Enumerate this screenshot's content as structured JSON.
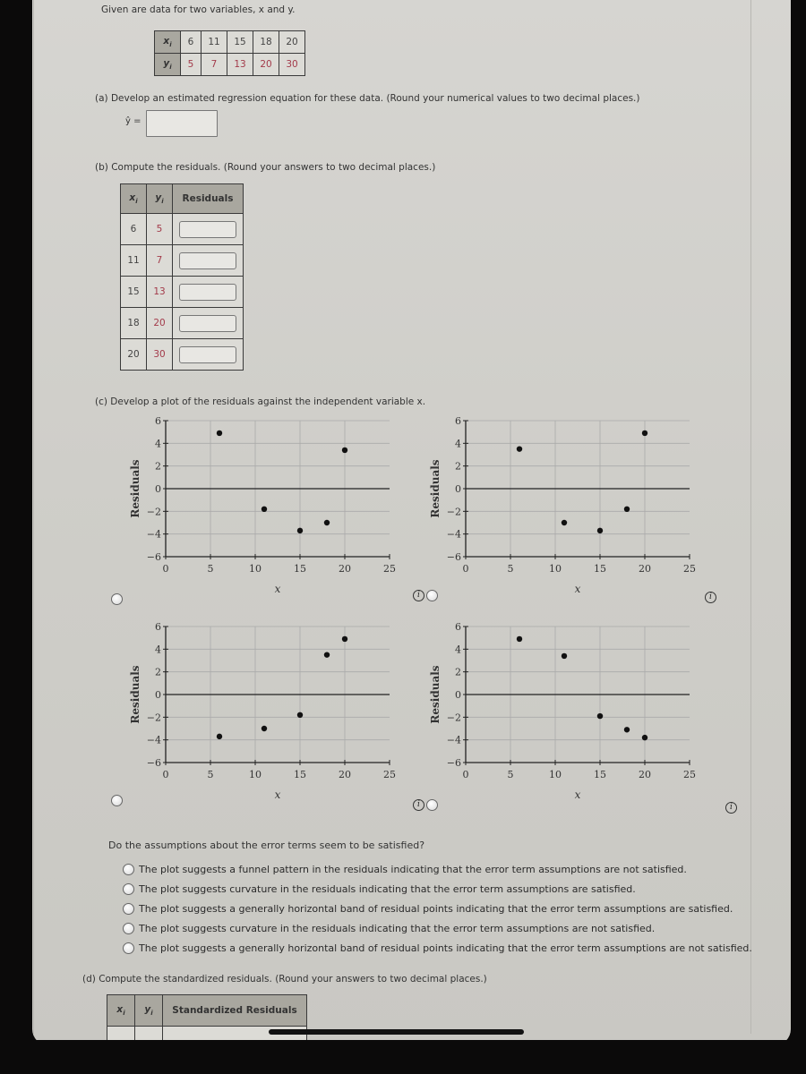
{
  "intro": "Given are data for two variables, x and y.",
  "given_table": {
    "x_label": "x",
    "y_label": "y",
    "subscript": "i",
    "x": [
      "6",
      "11",
      "15",
      "18",
      "20"
    ],
    "y": [
      "5",
      "7",
      "13",
      "20",
      "30"
    ]
  },
  "part_a": {
    "prompt": "(a)  Develop an estimated regression equation for these data. (Round your numerical values to two decimal places.)",
    "yhat_label": "ŷ =",
    "value": ""
  },
  "part_b": {
    "prompt": "(b)  Compute the residuals. (Round your answers to two decimal places.)",
    "headers": [
      "x",
      "y",
      "Residuals"
    ],
    "rows": [
      {
        "x": "6",
        "y": "5",
        "residual": ""
      },
      {
        "x": "11",
        "y": "7",
        "residual": ""
      },
      {
        "x": "15",
        "y": "13",
        "residual": ""
      },
      {
        "x": "18",
        "y": "20",
        "residual": ""
      },
      {
        "x": "20",
        "y": "30",
        "residual": ""
      }
    ]
  },
  "part_c": {
    "prompt": "(c)  Develop a plot of the residuals against the independent variable x.",
    "question": "Do the assumptions about the error terms seem to be satisfied?",
    "choices": [
      "The plot suggests a funnel pattern in the residuals indicating that the error term assumptions are not satisfied.",
      "The plot suggests curvature in the residuals indicating that the error term assumptions are satisfied.",
      "The plot suggests a generally horizontal band of residual points indicating that the error term assumptions are satisfied.",
      "The plot suggests curvature in the residuals indicating that the error term assumptions are not satisfied.",
      "The plot suggests a generally horizontal band of residual points indicating that the error term assumptions are not satisfied."
    ]
  },
  "part_d": {
    "prompt": "(d)  Compute the standardized residuals. (Round your answers to two decimal places.)",
    "headers": [
      "x",
      "y",
      "Standardized Residuals"
    ]
  },
  "chart_data": [
    {
      "type": "scatter",
      "position": "top-left",
      "xlabel": "x",
      "ylabel": "Residuals",
      "xlim": [
        0,
        25
      ],
      "ylim": [
        -6,
        6
      ],
      "xticks": [
        "0",
        "5",
        "10",
        "15",
        "20",
        "25"
      ],
      "yticks": [
        "6",
        "4",
        "2",
        "0",
        "−2",
        "−4",
        "−6"
      ],
      "grid": true,
      "points": [
        [
          6,
          4.9
        ],
        [
          11,
          -1.8
        ],
        [
          15,
          -3.7
        ],
        [
          18,
          -3.0
        ],
        [
          20,
          3.4
        ]
      ]
    },
    {
      "type": "scatter",
      "position": "top-right",
      "xlabel": "x",
      "ylabel": "Residuals",
      "xlim": [
        0,
        25
      ],
      "ylim": [
        -6,
        6
      ],
      "xticks": [
        "0",
        "5",
        "10",
        "15",
        "20",
        "25"
      ],
      "yticks": [
        "6",
        "4",
        "2",
        "0",
        "−2",
        "−4",
        "−6"
      ],
      "grid": true,
      "points": [
        [
          6,
          3.5
        ],
        [
          11,
          -3.0
        ],
        [
          15,
          -3.7
        ],
        [
          18,
          -1.8
        ],
        [
          20,
          4.9
        ]
      ]
    },
    {
      "type": "scatter",
      "position": "bottom-left",
      "xlabel": "x",
      "ylabel": "Residuals",
      "xlim": [
        0,
        25
      ],
      "ylim": [
        -6,
        6
      ],
      "xticks": [
        "0",
        "5",
        "10",
        "15",
        "20",
        "25"
      ],
      "yticks": [
        "6",
        "4",
        "2",
        "0",
        "−2",
        "−4",
        "−6"
      ],
      "grid": true,
      "points": [
        [
          6,
          -3.7
        ],
        [
          11,
          -3.0
        ],
        [
          15,
          -1.8
        ],
        [
          18,
          3.5
        ],
        [
          20,
          4.9
        ]
      ]
    },
    {
      "type": "scatter",
      "position": "bottom-right",
      "xlabel": "x",
      "ylabel": "Residuals",
      "xlim": [
        0,
        25
      ],
      "ylim": [
        -6,
        6
      ],
      "xticks": [
        "0",
        "5",
        "10",
        "15",
        "20",
        "25"
      ],
      "yticks": [
        "6",
        "4",
        "2",
        "0",
        "−2",
        "−4",
        "−6"
      ],
      "grid": true,
      "points": [
        [
          6,
          4.9
        ],
        [
          11,
          3.4
        ],
        [
          15,
          -1.9
        ],
        [
          18,
          -3.1
        ],
        [
          20,
          -3.8
        ]
      ]
    }
  ]
}
